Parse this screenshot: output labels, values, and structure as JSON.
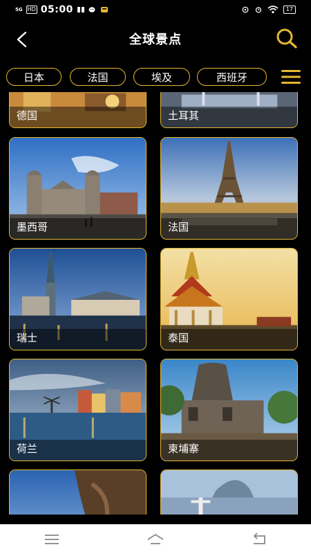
{
  "status": {
    "signal": "5G",
    "hd": "HD",
    "time": "05:00",
    "battery": "17"
  },
  "header": {
    "title": "全球景点",
    "back_icon": "chevron-left-icon",
    "search_icon": "search-icon",
    "accent": "#e6b833"
  },
  "tabs": [
    "日本",
    "法国",
    "埃及",
    "西班牙"
  ],
  "menu_icon": "hamburger-menu-icon",
  "cards": [
    {
      "label": "德国"
    },
    {
      "label": "土耳其"
    },
    {
      "label": "墨西哥"
    },
    {
      "label": "法国"
    },
    {
      "label": "瑞士"
    },
    {
      "label": "泰国"
    },
    {
      "label": "荷兰"
    },
    {
      "label": "柬埔寨"
    },
    {
      "label": ""
    },
    {
      "label": ""
    }
  ],
  "nav": {
    "menu_icon": "recent-apps-icon",
    "home_icon": "home-icon",
    "back_icon": "return-icon"
  }
}
